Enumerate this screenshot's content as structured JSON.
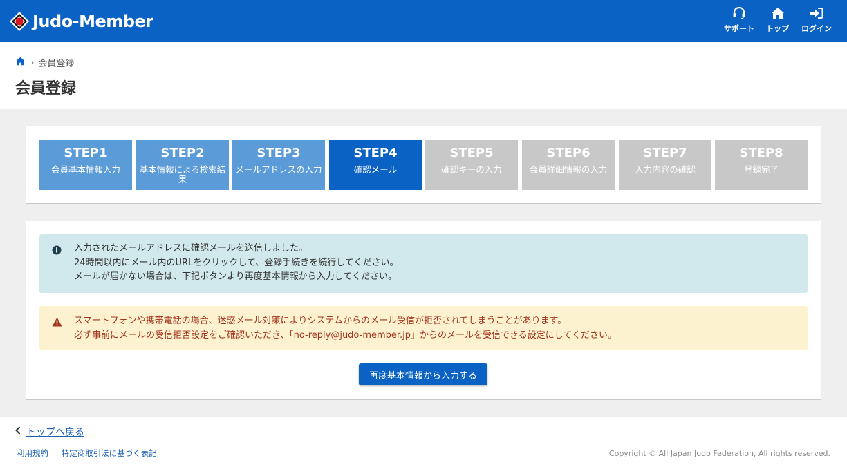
{
  "header": {
    "logo_text": "Judo-Member",
    "nav": {
      "support": "サポート",
      "top": "トップ",
      "login": "ログイン"
    },
    "bg_color": "#0a62c4"
  },
  "breadcrumb": {
    "current": "会員登録"
  },
  "page_title": "会員登録",
  "steps": [
    {
      "num": "STEP1",
      "label": "会員基本情報入力",
      "state": "done"
    },
    {
      "num": "STEP2",
      "label": "基本情報による検索結果",
      "state": "done"
    },
    {
      "num": "STEP3",
      "label": "メールアドレスの入力",
      "state": "done"
    },
    {
      "num": "STEP4",
      "label": "確認メール",
      "state": "current"
    },
    {
      "num": "STEP5",
      "label": "確認キーの入力",
      "state": "todo"
    },
    {
      "num": "STEP6",
      "label": "会員詳細情報の入力",
      "state": "todo"
    },
    {
      "num": "STEP7",
      "label": "入力内容の確認",
      "state": "todo"
    },
    {
      "num": "STEP8",
      "label": "登録完了",
      "state": "todo"
    }
  ],
  "info_alert": {
    "lines": [
      "入力されたメールアドレスに確認メールを送信しました。",
      "24時間以内にメール内のURLをクリックして、登録手続きを続行してください。",
      "メールが届かない場合は、下記ボタンより再度基本情報から入力してください。"
    ]
  },
  "warn_alert": {
    "lines": [
      "スマートフォンや携帯電話の場合、迷惑メール対策によりシステムからのメール受信が拒否されてしまうことがあります。",
      "必ず事前にメールの受信拒否設定をご確認いただき、「no-reply@judo-member.jp」からのメールを受信できる設定にしてください。"
    ]
  },
  "reenter_button": "再度基本情報から入力する",
  "footer": {
    "back_link": "トップへ戻る",
    "terms_link": "利用規約",
    "commerce_link": "特定商取引法に基づく表記",
    "copyright": "Copyright © All Japan Judo Federation, All rights reserved."
  },
  "colors": {
    "primary": "#0a62c4",
    "step_done": "#5a9bd8",
    "step_todo": "#c8c8c8",
    "info_bg": "#d1e9ec",
    "warn_bg": "#fdf2cf",
    "warn_text": "#a3341d"
  }
}
